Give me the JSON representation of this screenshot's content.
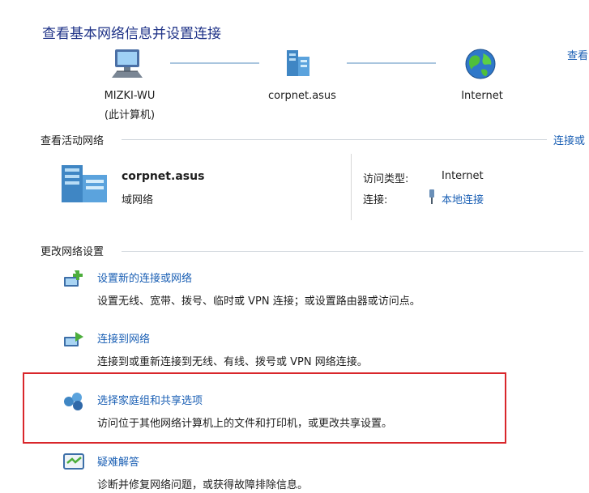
{
  "header": {
    "title": "查看基本网络信息并设置连接",
    "view_full_map_link": "查看"
  },
  "network_map": {
    "nodes": [
      {
        "label": "MIZKI-WU",
        "sublabel": "(此计算机)",
        "icon": "computer-icon"
      },
      {
        "label": "corpnet.asus",
        "icon": "domain-network-icon"
      },
      {
        "label": "Internet",
        "icon": "globe-icon"
      }
    ]
  },
  "active_networks": {
    "section_label": "查看活动网络",
    "connect_link": "连接或",
    "network_name": "corpnet.asus",
    "network_type": "域网络",
    "access_type_label": "访问类型:",
    "access_type_value": "Internet",
    "connections_label": "连接:",
    "connection_link": "本地连接"
  },
  "change_settings": {
    "section_label": "更改网络设置",
    "items": [
      {
        "title": "设置新的连接或网络",
        "desc": "设置无线、宽带、拨号、临时或 VPN 连接；或设置路由器或访问点。",
        "icon": "new-connection-icon"
      },
      {
        "title": "连接到网络",
        "desc": "连接到或重新连接到无线、有线、拨号或 VPN 网络连接。",
        "icon": "connect-network-icon"
      },
      {
        "title": "选择家庭组和共享选项",
        "desc": "访问位于其他网络计算机上的文件和打印机，或更改共享设置。",
        "icon": "homegroup-icon"
      },
      {
        "title": "疑难解答",
        "desc": "诊断并修复网络问题，或获得故障排除信息。",
        "icon": "troubleshoot-icon"
      }
    ]
  },
  "colors": {
    "link": "#1a5fb4",
    "title": "#1e3287",
    "highlight_box": "#d9262b"
  }
}
